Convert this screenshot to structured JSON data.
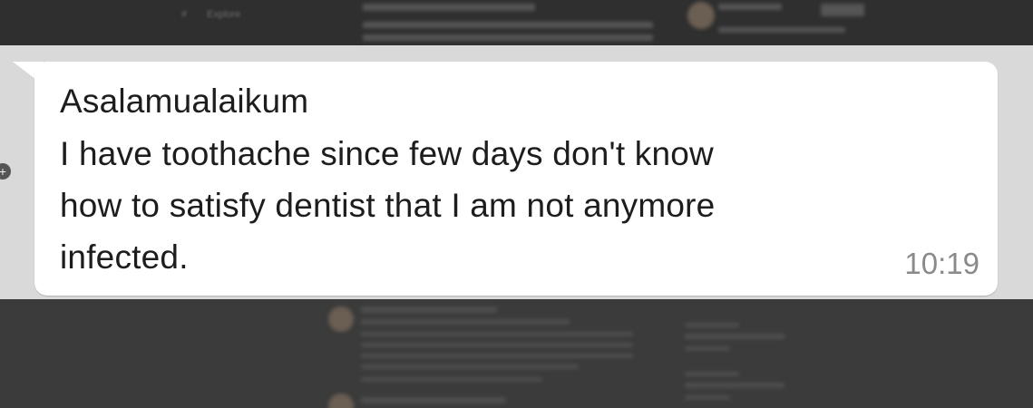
{
  "background_top": {
    "nav_label": "Explore",
    "nav_icon": "hashtag-icon"
  },
  "message": {
    "lines": [
      "Asalamualaikum",
      "I have toothache since few days don't know",
      "how to satisfy dentist that I am not anymore",
      "infected."
    ],
    "time": "10:19"
  },
  "colors": {
    "bubble": "#ffffff",
    "chat_background": "#d9d9d9",
    "text": "#1d1d1d",
    "timestamp": "#8a8a8a"
  }
}
